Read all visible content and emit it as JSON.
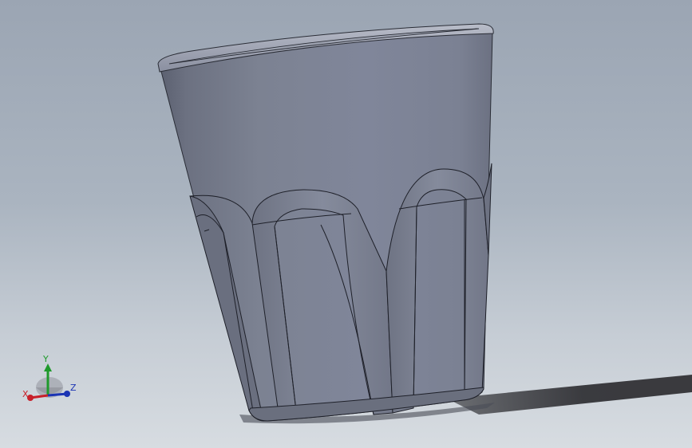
{
  "viewport": {
    "model": "cup",
    "background_top": "#9ba5b3",
    "background_bottom": "#d7dce1",
    "model_color": "#7a7f8d"
  },
  "triad": {
    "x_label": "X",
    "y_label": "Y",
    "z_label": "Z",
    "x_color": "#c8202a",
    "y_color": "#1f9a2c",
    "z_color": "#1b34b4"
  }
}
